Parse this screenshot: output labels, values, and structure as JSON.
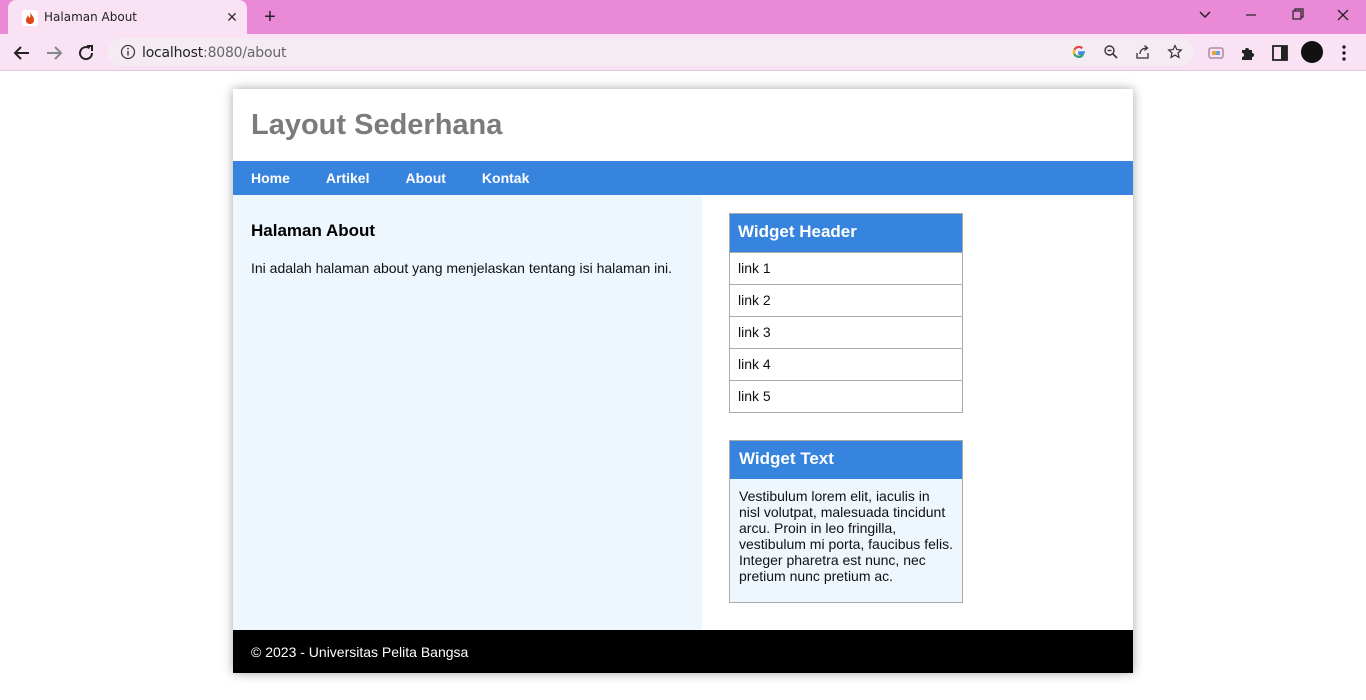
{
  "browser": {
    "tab_title": "Halaman About",
    "url_host": "localhost",
    "url_path": ":8080/about",
    "tab_color": "#ea8ad6",
    "toolbar_color": "#f8e2f3"
  },
  "site": {
    "title": "Layout Sederhana",
    "nav": [
      "Home",
      "Artikel",
      "About",
      "Kontak"
    ],
    "accent_color": "#3784df"
  },
  "content": {
    "heading": "Halaman About",
    "paragraph": "Ini adalah halaman about yang menjelaskan tentang isi halaman ini."
  },
  "sidebar": {
    "widget_links": {
      "header": "Widget Header",
      "links": [
        "link 1",
        "link 2",
        "link 3",
        "link 4",
        "link 5"
      ]
    },
    "widget_text": {
      "header": "Widget Text",
      "body": "Vestibulum lorem elit, iaculis in nisl volutpat, malesuada tincidunt arcu. Proin in leo fringilla, vestibulum mi porta, faucibus felis. Integer pharetra est nunc, nec pretium nunc pretium ac."
    }
  },
  "footer": {
    "text": "© 2023 - Universitas Pelita Bangsa"
  }
}
